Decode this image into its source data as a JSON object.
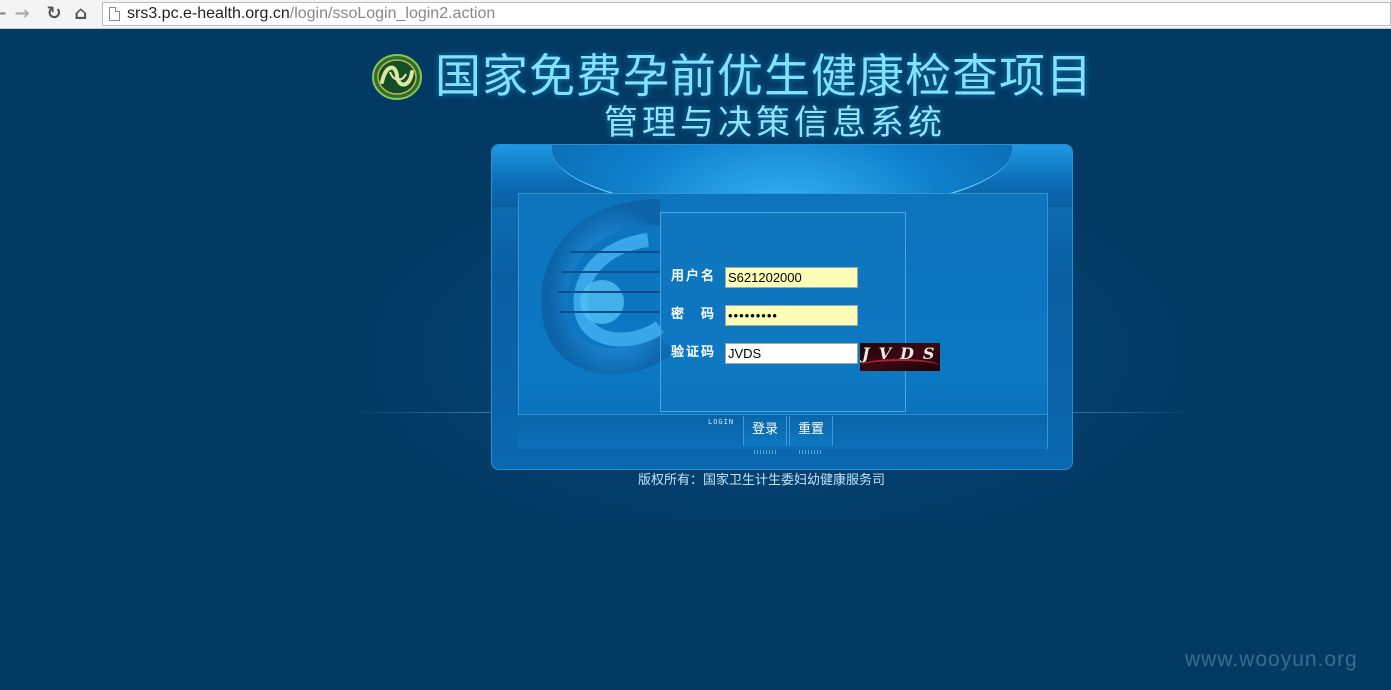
{
  "browser": {
    "url_host": "srs3.pc.e-health.org.cn",
    "url_path": "/login/ssoLogin_login2.action",
    "back_icon": "arrow-left-icon",
    "forward_icon": "arrow-right-icon",
    "reload_icon": "reload-icon",
    "home_icon": "home-icon"
  },
  "header": {
    "title": "国家免费孕前优生健康检查项目",
    "subtitle": "管理与决策信息系统"
  },
  "form": {
    "username_label": "用户名",
    "password_label": "密　码",
    "captcha_label": "验证码",
    "username_value": "S621202000",
    "password_value": "•••••••••",
    "captcha_value": "JVDS",
    "captcha_image_text": "JVDS"
  },
  "buttons": {
    "login_tag": "LOGIN",
    "login": "登录",
    "reset": "重置"
  },
  "footer": {
    "copyright": "版权所有：国家卫生计生委妇幼健康服务司"
  },
  "watermark": "www.wooyun.org",
  "colors": {
    "background": "#033a64",
    "title": "#7fe2ff",
    "input_autofill": "#fefdb8",
    "panel": "#0a64a8"
  }
}
